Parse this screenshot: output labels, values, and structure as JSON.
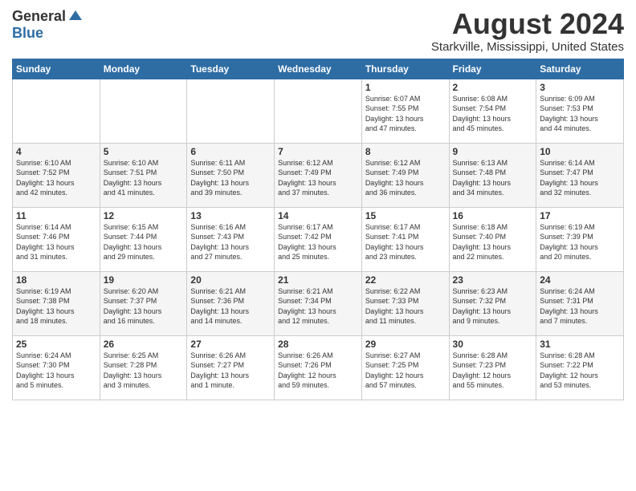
{
  "logo": {
    "general": "General",
    "blue": "Blue"
  },
  "title": "August 2024",
  "subtitle": "Starkville, Mississippi, United States",
  "days_header": [
    "Sunday",
    "Monday",
    "Tuesday",
    "Wednesday",
    "Thursday",
    "Friday",
    "Saturday"
  ],
  "weeks": [
    [
      {
        "day": "",
        "info": ""
      },
      {
        "day": "",
        "info": ""
      },
      {
        "day": "",
        "info": ""
      },
      {
        "day": "",
        "info": ""
      },
      {
        "day": "1",
        "info": "Sunrise: 6:07 AM\nSunset: 7:55 PM\nDaylight: 13 hours\nand 47 minutes."
      },
      {
        "day": "2",
        "info": "Sunrise: 6:08 AM\nSunset: 7:54 PM\nDaylight: 13 hours\nand 45 minutes."
      },
      {
        "day": "3",
        "info": "Sunrise: 6:09 AM\nSunset: 7:53 PM\nDaylight: 13 hours\nand 44 minutes."
      }
    ],
    [
      {
        "day": "4",
        "info": "Sunrise: 6:10 AM\nSunset: 7:52 PM\nDaylight: 13 hours\nand 42 minutes."
      },
      {
        "day": "5",
        "info": "Sunrise: 6:10 AM\nSunset: 7:51 PM\nDaylight: 13 hours\nand 41 minutes."
      },
      {
        "day": "6",
        "info": "Sunrise: 6:11 AM\nSunset: 7:50 PM\nDaylight: 13 hours\nand 39 minutes."
      },
      {
        "day": "7",
        "info": "Sunrise: 6:12 AM\nSunset: 7:49 PM\nDaylight: 13 hours\nand 37 minutes."
      },
      {
        "day": "8",
        "info": "Sunrise: 6:12 AM\nSunset: 7:49 PM\nDaylight: 13 hours\nand 36 minutes."
      },
      {
        "day": "9",
        "info": "Sunrise: 6:13 AM\nSunset: 7:48 PM\nDaylight: 13 hours\nand 34 minutes."
      },
      {
        "day": "10",
        "info": "Sunrise: 6:14 AM\nSunset: 7:47 PM\nDaylight: 13 hours\nand 32 minutes."
      }
    ],
    [
      {
        "day": "11",
        "info": "Sunrise: 6:14 AM\nSunset: 7:46 PM\nDaylight: 13 hours\nand 31 minutes."
      },
      {
        "day": "12",
        "info": "Sunrise: 6:15 AM\nSunset: 7:44 PM\nDaylight: 13 hours\nand 29 minutes."
      },
      {
        "day": "13",
        "info": "Sunrise: 6:16 AM\nSunset: 7:43 PM\nDaylight: 13 hours\nand 27 minutes."
      },
      {
        "day": "14",
        "info": "Sunrise: 6:17 AM\nSunset: 7:42 PM\nDaylight: 13 hours\nand 25 minutes."
      },
      {
        "day": "15",
        "info": "Sunrise: 6:17 AM\nSunset: 7:41 PM\nDaylight: 13 hours\nand 23 minutes."
      },
      {
        "day": "16",
        "info": "Sunrise: 6:18 AM\nSunset: 7:40 PM\nDaylight: 13 hours\nand 22 minutes."
      },
      {
        "day": "17",
        "info": "Sunrise: 6:19 AM\nSunset: 7:39 PM\nDaylight: 13 hours\nand 20 minutes."
      }
    ],
    [
      {
        "day": "18",
        "info": "Sunrise: 6:19 AM\nSunset: 7:38 PM\nDaylight: 13 hours\nand 18 minutes."
      },
      {
        "day": "19",
        "info": "Sunrise: 6:20 AM\nSunset: 7:37 PM\nDaylight: 13 hours\nand 16 minutes."
      },
      {
        "day": "20",
        "info": "Sunrise: 6:21 AM\nSunset: 7:36 PM\nDaylight: 13 hours\nand 14 minutes."
      },
      {
        "day": "21",
        "info": "Sunrise: 6:21 AM\nSunset: 7:34 PM\nDaylight: 13 hours\nand 12 minutes."
      },
      {
        "day": "22",
        "info": "Sunrise: 6:22 AM\nSunset: 7:33 PM\nDaylight: 13 hours\nand 11 minutes."
      },
      {
        "day": "23",
        "info": "Sunrise: 6:23 AM\nSunset: 7:32 PM\nDaylight: 13 hours\nand 9 minutes."
      },
      {
        "day": "24",
        "info": "Sunrise: 6:24 AM\nSunset: 7:31 PM\nDaylight: 13 hours\nand 7 minutes."
      }
    ],
    [
      {
        "day": "25",
        "info": "Sunrise: 6:24 AM\nSunset: 7:30 PM\nDaylight: 13 hours\nand 5 minutes."
      },
      {
        "day": "26",
        "info": "Sunrise: 6:25 AM\nSunset: 7:28 PM\nDaylight: 13 hours\nand 3 minutes."
      },
      {
        "day": "27",
        "info": "Sunrise: 6:26 AM\nSunset: 7:27 PM\nDaylight: 13 hours\nand 1 minute."
      },
      {
        "day": "28",
        "info": "Sunrise: 6:26 AM\nSunset: 7:26 PM\nDaylight: 12 hours\nand 59 minutes."
      },
      {
        "day": "29",
        "info": "Sunrise: 6:27 AM\nSunset: 7:25 PM\nDaylight: 12 hours\nand 57 minutes."
      },
      {
        "day": "30",
        "info": "Sunrise: 6:28 AM\nSunset: 7:23 PM\nDaylight: 12 hours\nand 55 minutes."
      },
      {
        "day": "31",
        "info": "Sunrise: 6:28 AM\nSunset: 7:22 PM\nDaylight: 12 hours\nand 53 minutes."
      }
    ]
  ]
}
